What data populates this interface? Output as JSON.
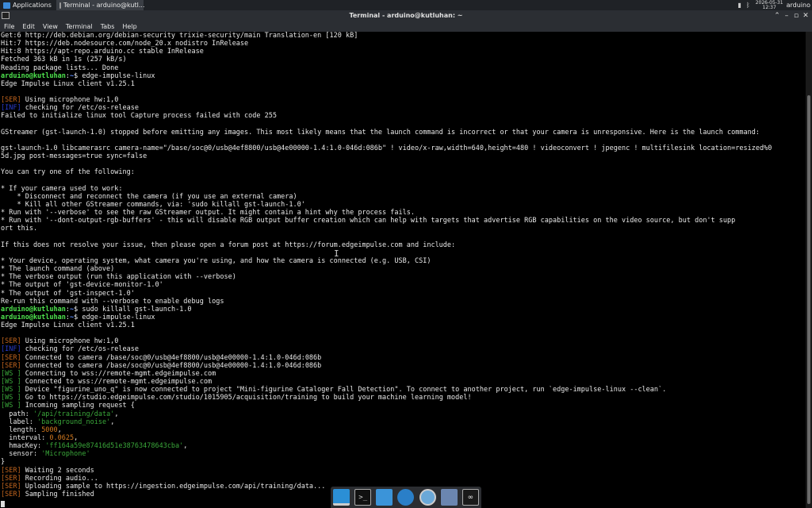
{
  "panel": {
    "applications": "Applications",
    "task_title": "Terminal - arduino@kutl...",
    "clock_date": "2026-05-31",
    "clock_time": "12:37",
    "user": "arduino"
  },
  "window": {
    "title": "Terminal - arduino@kutluhan: ~"
  },
  "menu": [
    "File",
    "Edit",
    "View",
    "Terminal",
    "Tabs",
    "Help"
  ],
  "terminal": {
    "lines": [
      [
        [
          "t",
          "Get:6 http://deb.debian.org/debian-security trixie-security/main Translation-en [120 kB]"
        ]
      ],
      [
        [
          "t",
          "Hit:7 https://deb.nodesource.com/node_20.x nodistro InRelease"
        ]
      ],
      [
        [
          "t",
          "Hit:8 https://apt-repo.arduino.cc stable InRelease"
        ]
      ],
      [
        [
          "t",
          "Fetched 363 kB in 1s (257 kB/s)"
        ]
      ],
      [
        [
          "t",
          "Reading package lists... Done"
        ]
      ],
      [
        [
          "green",
          "arduino@kutluhan"
        ],
        [
          "t",
          ":"
        ],
        [
          "blue",
          "~"
        ],
        [
          "t",
          "$ edge-impulse-linux"
        ]
      ],
      [
        [
          "t",
          "Edge Impulse Linux client v1.25.1"
        ]
      ],
      [
        [
          "t",
          ""
        ]
      ],
      [
        [
          "ser",
          "[SER]"
        ],
        [
          "t",
          " Using microphone hw:1,0"
        ]
      ],
      [
        [
          "dbg",
          "[INF]"
        ],
        [
          "t",
          " checking for /etc/os-release"
        ]
      ],
      [
        [
          "t",
          "Failed to initialize linux tool Capture process failed with code 255"
        ]
      ],
      [
        [
          "t",
          ""
        ]
      ],
      [
        [
          "t",
          "GStreamer (gst-launch-1.0) stopped before emitting any images. This most likely means that the launch command is incorrect or that your camera is unresponsive. Here is the launch command:"
        ]
      ],
      [
        [
          "t",
          ""
        ]
      ],
      [
        [
          "t",
          "gst-launch-1.0 libcamerasrc camera-name=\"/base/soc@0/usb@4ef8800/usb@4e00000-1.4:1.0-046d:086b\" ! video/x-raw,width=640,height=480 ! videoconvert ! jpegenc ! multifilesink location=resized%0"
        ]
      ],
      [
        [
          "t",
          "5d.jpg post-messages=true sync=false"
        ]
      ],
      [
        [
          "t",
          ""
        ]
      ],
      [
        [
          "t",
          "You can try one of the following:"
        ]
      ],
      [
        [
          "t",
          ""
        ]
      ],
      [
        [
          "t",
          "* If your camera used to work:"
        ]
      ],
      [
        [
          "t",
          "    * Disconnect and reconnect the camera (if you use an external camera)"
        ]
      ],
      [
        [
          "t",
          "    * Kill all other GStreamer commands, via: 'sudo killall gst-launch-1.0'"
        ]
      ],
      [
        [
          "t",
          "* Run with '--verbose' to see the raw GStreamer output. It might contain a hint why the process fails."
        ]
      ],
      [
        [
          "t",
          "* Run with '--dont-output-rgb-buffers' - this will disable RGB output buffer creation which can help with targets that advertise RGB capabilities on the video source, but don't supp"
        ]
      ],
      [
        [
          "t",
          "ort this."
        ]
      ],
      [
        [
          "t",
          ""
        ]
      ],
      [
        [
          "t",
          "If this does not resolve your issue, then please open a forum post at https://forum.edgeimpulse.com and include:"
        ]
      ],
      [
        [
          "t",
          ""
        ]
      ],
      [
        [
          "t",
          "* Your device, operating system, what camera you're using, and how the camera is connected (e.g. USB, CSI)"
        ]
      ],
      [
        [
          "t",
          "* The launch command (above)"
        ]
      ],
      [
        [
          "t",
          "* The verbose output (run this application with --verbose)"
        ]
      ],
      [
        [
          "t",
          "* The output of 'gst-device-monitor-1.0'"
        ]
      ],
      [
        [
          "t",
          "* The output of 'gst-inspect-1.0'"
        ]
      ],
      [
        [
          "t",
          "Re-run this command with --verbose to enable debug logs"
        ]
      ],
      [
        [
          "green",
          "arduino@kutluhan"
        ],
        [
          "t",
          ":"
        ],
        [
          "blue",
          "~"
        ],
        [
          "t",
          "$ sudo killall gst-launch-1.0"
        ]
      ],
      [
        [
          "green",
          "arduino@kutluhan"
        ],
        [
          "t",
          ":"
        ],
        [
          "blue",
          "~"
        ],
        [
          "t",
          "$ edge-impulse-linux"
        ]
      ],
      [
        [
          "t",
          "Edge Impulse Linux client v1.25.1"
        ]
      ],
      [
        [
          "t",
          ""
        ]
      ],
      [
        [
          "ser",
          "[SER]"
        ],
        [
          "t",
          " Using microphone hw:1,0"
        ]
      ],
      [
        [
          "dbg",
          "[INF]"
        ],
        [
          "t",
          " checking for /etc/os-release"
        ]
      ],
      [
        [
          "ser",
          "[SER]"
        ],
        [
          "t",
          " Connected to camera /base/soc@0/usb@4ef8800/usb@4e00000-1.4:1.0-046d:086b"
        ]
      ],
      [
        [
          "ser",
          "[SER]"
        ],
        [
          "t",
          " Connected to camera /base/soc@0/usb@4ef8800/usb@4e00000-1.4:1.0-046d:086b"
        ]
      ],
      [
        [
          "ws",
          "[WS ]"
        ],
        [
          "t",
          " Connecting to wss://remote-mgmt.edgeimpulse.com"
        ]
      ],
      [
        [
          "ws",
          "[WS ]"
        ],
        [
          "t",
          " Connected to wss://remote-mgmt.edgeimpulse.com"
        ]
      ],
      [
        [
          "ws",
          "[WS ]"
        ],
        [
          "t",
          " Device \"figurine_uno_q\" is now connected to project \"Mini-figurine Cataloger Fall Detection\". To connect to another project, run `edge-impulse-linux --clean`."
        ]
      ],
      [
        [
          "ws",
          "[WS ]"
        ],
        [
          "t",
          " Go to https://studio.edgeimpulse.com/studio/1015905/acquisition/training to build your machine learning model!"
        ]
      ],
      [
        [
          "ws",
          "[WS ]"
        ],
        [
          "t",
          " Incoming sampling request {"
        ]
      ],
      [
        [
          "t",
          "  path: "
        ],
        [
          "str",
          "'/api/training/data'"
        ],
        [
          "t",
          ","
        ]
      ],
      [
        [
          "t",
          "  label: "
        ],
        [
          "str",
          "'background_noise'"
        ],
        [
          "t",
          ","
        ]
      ],
      [
        [
          "t",
          "  length: "
        ],
        [
          "num",
          "5000"
        ],
        [
          "t",
          ","
        ]
      ],
      [
        [
          "t",
          "  interval: "
        ],
        [
          "num",
          "0.0625"
        ],
        [
          "t",
          ","
        ]
      ],
      [
        [
          "t",
          "  hmacKey: "
        ],
        [
          "str",
          "'ff164a59e87416d51e38763478643cba'"
        ],
        [
          "t",
          ","
        ]
      ],
      [
        [
          "t",
          "  sensor: "
        ],
        [
          "str",
          "'Microphone'"
        ]
      ],
      [
        [
          "t",
          "}"
        ]
      ],
      [
        [
          "ser",
          "[SER]"
        ],
        [
          "t",
          " Waiting 2 seconds"
        ]
      ],
      [
        [
          "ser",
          "[SER]"
        ],
        [
          "t",
          " Recording audio..."
        ]
      ],
      [
        [
          "ser",
          "[SER]"
        ],
        [
          "t",
          " Uploading sample to https://ingestion.edgeimpulse.com/api/training/data..."
        ]
      ],
      [
        [
          "ser",
          "[SER]"
        ],
        [
          "t",
          " Sampling finished"
        ]
      ]
    ]
  },
  "dock": {
    "terminal_glyph": ">_",
    "arduino_glyph": "∞"
  }
}
